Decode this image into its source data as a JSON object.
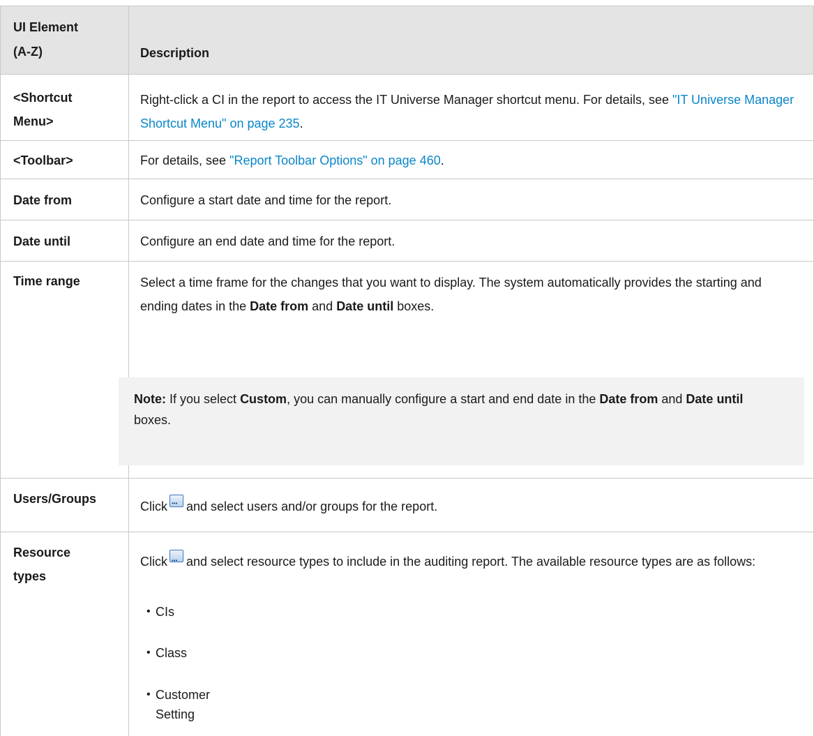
{
  "header": {
    "col1_line1": "UI Element",
    "col1_line2": "(A-Z)",
    "col2": "Description"
  },
  "rows": {
    "shortcut": {
      "name_line1": "<Shortcut",
      "name_line2": "Menu>",
      "text_a": "Right-click a CI in the report to access the IT Universe Manager shortcut menu. For details, see ",
      "link": "\"IT Universe Manager Shortcut Menu\" on page 235",
      "text_b": "."
    },
    "toolbar": {
      "name": "<Toolbar>",
      "text_a": "For details, see ",
      "link": "\"Report Toolbar Options\" on page 460",
      "text_b": "."
    },
    "date_from": {
      "name": "Date from",
      "text": "Configure a start date and time for the report."
    },
    "date_until": {
      "name": "Date until",
      "text": "Configure an end date and time for the report."
    },
    "time_range": {
      "name": "Time range",
      "text_a": "Select a time frame for the changes that you want to display. The system automatically provides the starting and ending dates in the ",
      "bold_1": "Date from",
      "text_b": " and ",
      "bold_2": "Date until",
      "text_c": " boxes.",
      "note": {
        "label": "Note:",
        "text_a": " If you select ",
        "bold_custom": "Custom",
        "text_b": ", you can manually configure a start and end date in the ",
        "bold_1": "Date from",
        "text_c": " and ",
        "bold_2": "Date until",
        "text_d": " boxes."
      }
    },
    "users_groups": {
      "name": "Users/Groups",
      "text_a": "Click",
      "icon": "ellipsis-button-icon",
      "text_b": "and select users and/or groups for the report."
    },
    "resource_types": {
      "name_line1": "Resource",
      "name_line2": "types",
      "text_a": "Click",
      "icon": "ellipsis-button-icon",
      "text_b": "and select resource types to include in the auditing report. The available resource types are as follows:",
      "items": [
        "CIs",
        "Class",
        "Customer Setting"
      ]
    }
  },
  "colors": {
    "header_bg": "#e4e4e4",
    "link": "#0a86c9",
    "note_bg": "#f2f2f2",
    "border": "#c8c8c8"
  }
}
